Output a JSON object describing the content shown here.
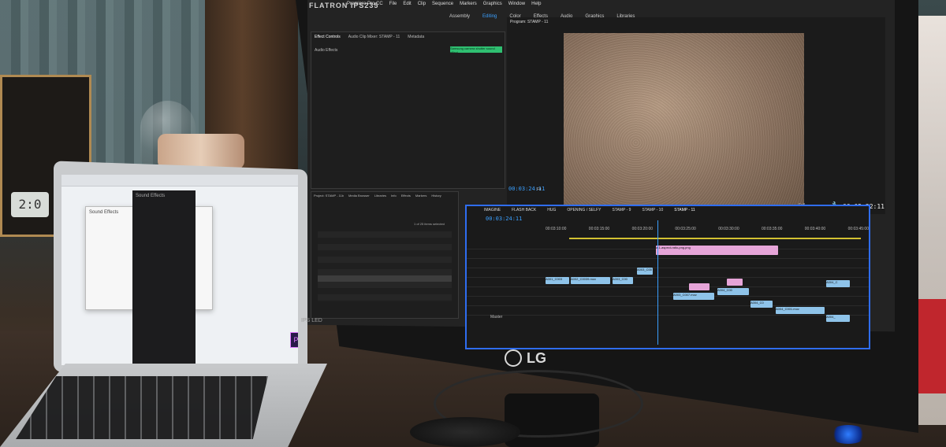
{
  "monitor": {
    "brand": "FLATRON IPS235",
    "logo": "LG",
    "panel_label": "IPS LED"
  },
  "premiere": {
    "app_title": "Premiere Pro CC",
    "menu": [
      "File",
      "Edit",
      "Clip",
      "Sequence",
      "Markers",
      "Graphics",
      "Window",
      "Help"
    ],
    "workspaces": [
      "Assembly",
      "Editing",
      "Color",
      "Effects",
      "Audio",
      "Graphics",
      "Libraries"
    ],
    "active_workspace": "Editing",
    "effect_controls_tab": "Effect Controls",
    "audio_mixer_tab": "Audio Clip Mixer: STAMP - 11",
    "metadata_tab": "Metadata",
    "audio_effects_label": "Audio Effects",
    "clip_label": "Samsung camera shutter sound effect",
    "program_title": "Program: STAMP - 11",
    "program_timecode": "00:03:24:11",
    "program_duration": "00:05:22:11",
    "fit_label": "Fit",
    "full_label": "Full",
    "project_tabs": [
      "Project: STAMP - 11b",
      "Media Browser",
      "Libraries",
      "Info",
      "Effects",
      "Markers",
      "History"
    ],
    "items_selected": "1 of 25 items selected",
    "timeline_tabs": [
      "IMAGINE",
      "FLASH BACK",
      "HUG",
      "OPENING / SELFY",
      "STAMP - 9",
      "STAMP - 10",
      "STAMP - 11"
    ],
    "timeline_timecode": "00:03:24:11",
    "ruler_ticks": [
      "00:03:10:00",
      "00:03:15:00",
      "00:03:20:00",
      "00:03:25:00",
      "00:03:30:00",
      "00:03:35:00",
      "00:03:40:00",
      "00:03:45:00"
    ],
    "pink_clip": "a-1-aspect-ratio-png.png",
    "clips": [
      "A001_C003",
      "A002_C0039.mov",
      "A003_C00",
      "A003_C00",
      "A003_C007.mov",
      "A004_C00",
      "A004_C0",
      "A004_C001.mov",
      "A004_C",
      "A004_"
    ],
    "master_label": "Master"
  },
  "laptop": {
    "dark_panel_label": "Sound Effects",
    "finder_label": "Sound Effects"
  },
  "desk_clock": "2:0"
}
